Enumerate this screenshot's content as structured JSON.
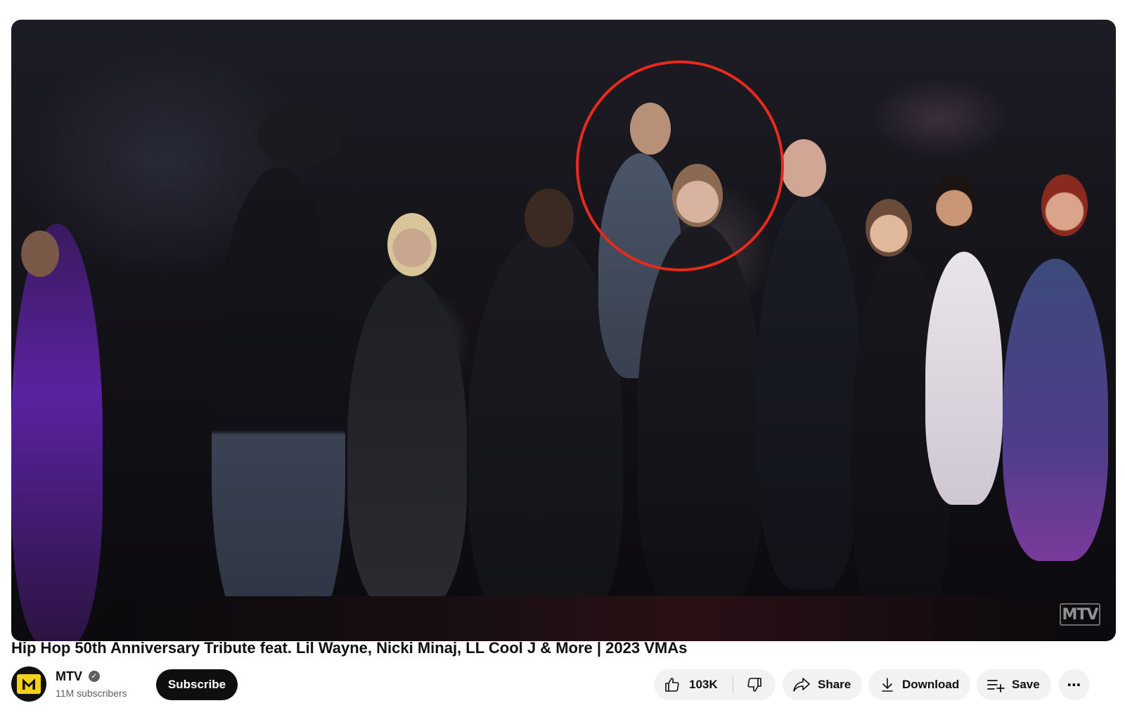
{
  "video": {
    "title": "Hip Hop 50th Anniversary Tribute feat. Lil Wayne, Nicki Minaj, LL Cool J & More | 2023 VMAs",
    "watermark": "MTV"
  },
  "channel": {
    "name": "MTV",
    "subscribers": "11M subscribers",
    "verified_icon": "verified-check-icon",
    "subscribe_label": "Subscribe"
  },
  "actions": {
    "like_count": "103K",
    "share_label": "Share",
    "download_label": "Download",
    "save_label": "Save",
    "more_label": "⋯"
  },
  "colors": {
    "highlight_circle": "#e8291c",
    "subscribe_bg": "#0f0f0f",
    "pill_bg": "#f2f2f2",
    "avatar_brand": "#f4d21b"
  }
}
